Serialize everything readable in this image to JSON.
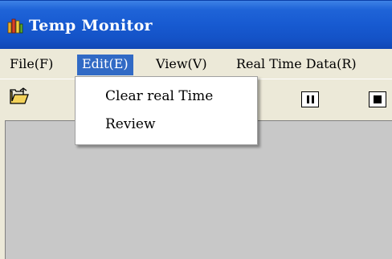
{
  "window": {
    "title": "Temp Monitor"
  },
  "menubar": {
    "items": [
      {
        "label": "File(F)"
      },
      {
        "label": "Edit(E)"
      },
      {
        "label": "View(V)"
      },
      {
        "label": "Real Time Data(R)"
      }
    ],
    "active": "Edit(E)"
  },
  "edit_menu": {
    "items": [
      {
        "label": "Clear real Time"
      },
      {
        "label": "Review"
      }
    ]
  },
  "toolbar": {
    "icons": [
      "open-folder-icon",
      "pause-icon",
      "stop-icon"
    ]
  },
  "colors": {
    "titlebar": "#1f64d8",
    "menu_highlight": "#316ac5",
    "content_bg": "#c8c8c8",
    "chrome": "#ece9d8"
  }
}
